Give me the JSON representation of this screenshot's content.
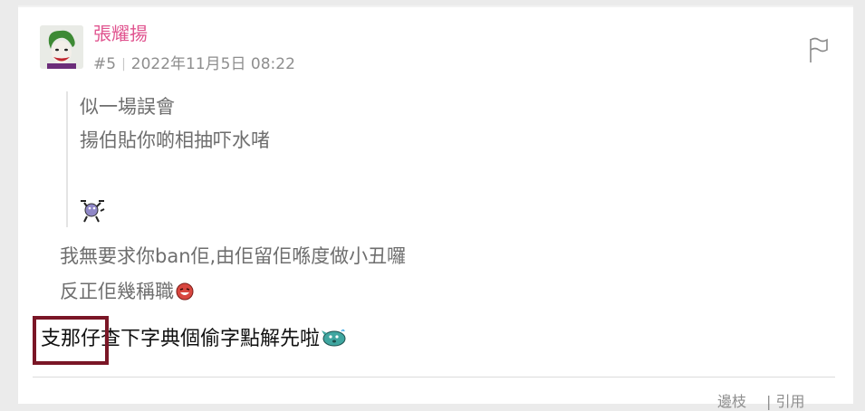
{
  "post": {
    "username": "張耀揚",
    "number": "#5",
    "separator": "|",
    "timestamp": "2022年11月5日 08:22",
    "avatar_icon": "joker-avatar",
    "flag_icon": "flag-icon"
  },
  "quote": {
    "lines": [
      "似一場誤會",
      "揚伯貼你啲相抽吓水啫"
    ],
    "emoji": "stick-figure-emoji"
  },
  "reply": {
    "line1": "我無要求你ban佢,由佢留佢喺度做小丑囉",
    "line2": "反正佢幾稱職",
    "line2_emoji": "laughing-face-emoji"
  },
  "main": {
    "text": "支那仔查下字典個偷字點解先啦",
    "emoji": "sweating-fish-emoji",
    "highlight_color": "#7a1626"
  },
  "footer": {
    "reply_label": "邊枝",
    "quote_label": "| 引用"
  },
  "colors": {
    "username": "#e0548f",
    "meta": "#8e8e8e",
    "body_text": "#6e6e6e"
  }
}
